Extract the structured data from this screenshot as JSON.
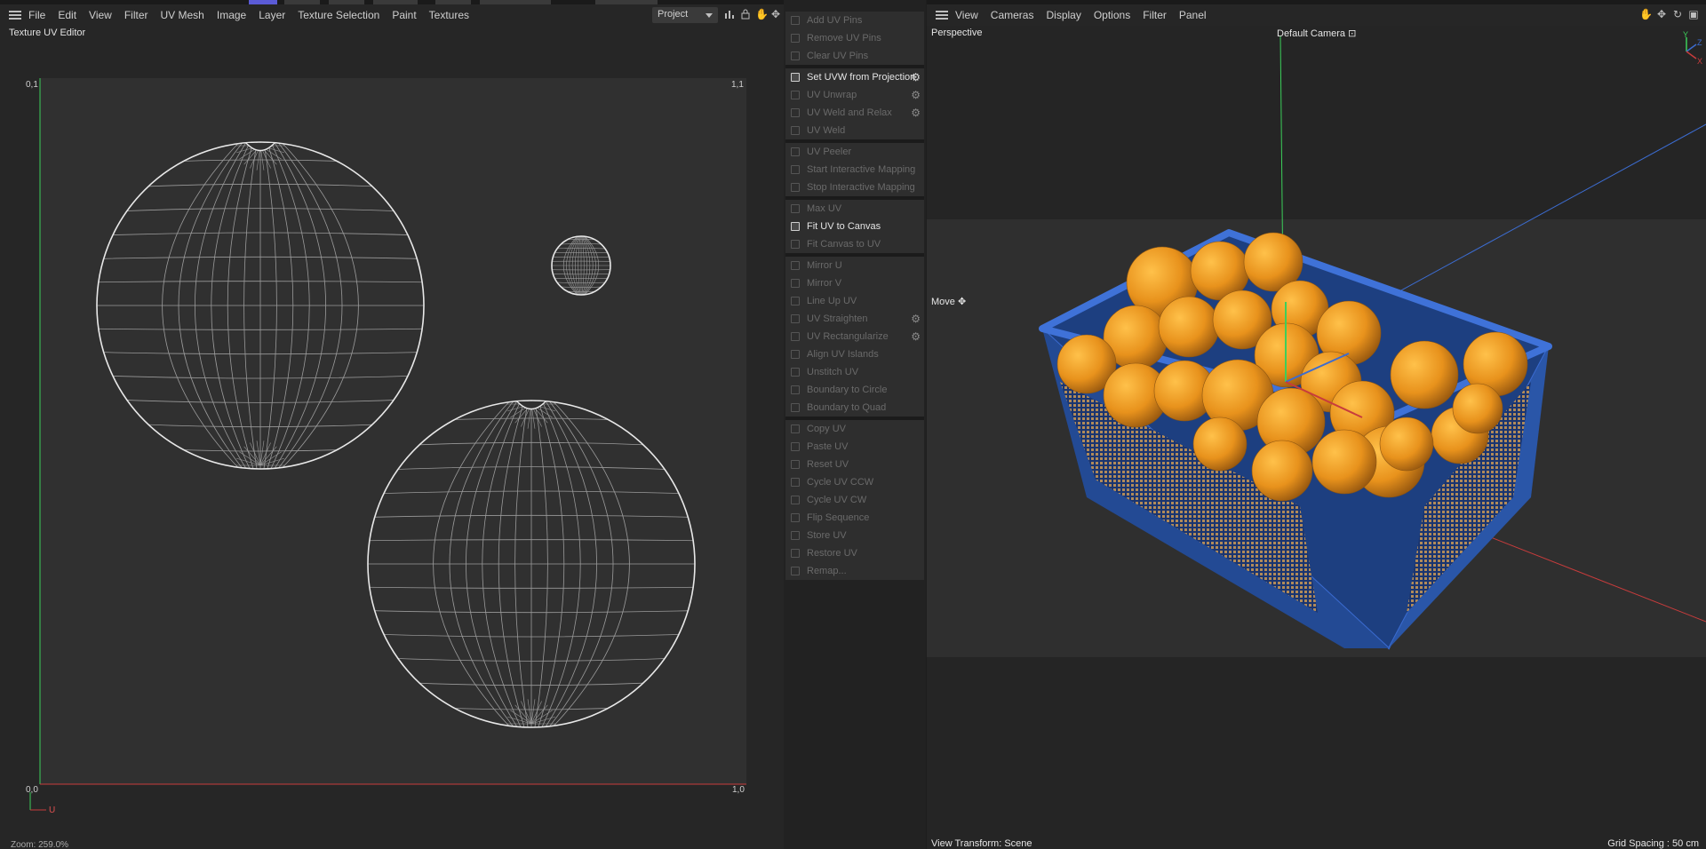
{
  "uv_editor": {
    "menu": [
      "File",
      "Edit",
      "View",
      "Filter",
      "UV Mesh",
      "Image",
      "Layer",
      "Texture Selection",
      "Paint",
      "Textures"
    ],
    "dropdown_value": "Project",
    "title": "Texture UV Editor",
    "corner_top_left": "0,1",
    "corner_top_right": "1,1",
    "corner_bottom_left": "0,0",
    "corner_bottom_right": "1,0",
    "axis_u": "U",
    "zoom": "Zoom: 259.0%",
    "accent_color": "#5b5bd6",
    "toolbar_icons": [
      "chart-icon",
      "lock-icon",
      "hand-icon",
      "move-icon"
    ]
  },
  "commands": [
    {
      "label": "Add UV Pins",
      "enabled": false,
      "gear": false
    },
    {
      "label": "Remove UV Pins",
      "enabled": false,
      "gear": false
    },
    {
      "label": "Clear UV Pins",
      "enabled": false,
      "gear": false
    },
    {
      "sep": true
    },
    {
      "label": "Set UVW from Projection",
      "enabled": true,
      "gear": true
    },
    {
      "label": "UV Unwrap",
      "enabled": false,
      "gear": true
    },
    {
      "label": "UV Weld and Relax",
      "enabled": false,
      "gear": true
    },
    {
      "label": "UV Weld",
      "enabled": false,
      "gear": false
    },
    {
      "sep": true
    },
    {
      "label": "UV Peeler",
      "enabled": false,
      "gear": false
    },
    {
      "label": "Start Interactive Mapping",
      "enabled": false,
      "gear": false
    },
    {
      "label": "Stop Interactive Mapping",
      "enabled": false,
      "gear": false
    },
    {
      "sep": true
    },
    {
      "label": "Max UV",
      "enabled": false,
      "gear": false
    },
    {
      "label": "Fit UV to Canvas",
      "enabled": true,
      "gear": false
    },
    {
      "label": "Fit Canvas to UV",
      "enabled": false,
      "gear": false
    },
    {
      "sep": true
    },
    {
      "label": "Mirror U",
      "enabled": false,
      "gear": false
    },
    {
      "label": "Mirror V",
      "enabled": false,
      "gear": false
    },
    {
      "label": "Line Up UV",
      "enabled": false,
      "gear": false
    },
    {
      "label": "UV Straighten",
      "enabled": false,
      "gear": true
    },
    {
      "label": "UV Rectangularize",
      "enabled": false,
      "gear": true
    },
    {
      "label": "Align UV Islands",
      "enabled": false,
      "gear": false
    },
    {
      "label": "Unstitch UV",
      "enabled": false,
      "gear": false
    },
    {
      "label": "Boundary to Circle",
      "enabled": false,
      "gear": false
    },
    {
      "label": "Boundary to Quad",
      "enabled": false,
      "gear": false
    },
    {
      "sep": true
    },
    {
      "label": "Copy UV",
      "enabled": false,
      "gear": false
    },
    {
      "label": "Paste UV",
      "enabled": false,
      "gear": false
    },
    {
      "label": "Reset UV",
      "enabled": false,
      "gear": false
    },
    {
      "label": "Cycle UV CCW",
      "enabled": false,
      "gear": false
    },
    {
      "label": "Cycle UV CW",
      "enabled": false,
      "gear": false
    },
    {
      "label": "Flip Sequence",
      "enabled": false,
      "gear": false
    },
    {
      "label": "Store UV",
      "enabled": false,
      "gear": false
    },
    {
      "label": "Restore UV",
      "enabled": false,
      "gear": false
    },
    {
      "label": "Remap...",
      "enabled": false,
      "gear": false
    }
  ],
  "viewport": {
    "menu": [
      "View",
      "Cameras",
      "Display",
      "Options",
      "Filter",
      "Panel"
    ],
    "view_name": "Perspective",
    "camera": "Default Camera",
    "tool": "Move",
    "view_transform": "View Transform: Scene",
    "grid_spacing": "Grid Spacing : 50 cm",
    "gizmo_y": "Y",
    "gizmo_z": "Z",
    "gizmo_x": "X",
    "colors": {
      "crate": "#2c56a8",
      "orange": "#e8921c",
      "grid_x": "#c83c3c",
      "grid_z": "#3c6cd0",
      "axis_y": "#3ccf5a"
    },
    "toolbar_icons": [
      "hand-icon",
      "move-icon",
      "rotate-icon",
      "maximize-icon"
    ]
  }
}
